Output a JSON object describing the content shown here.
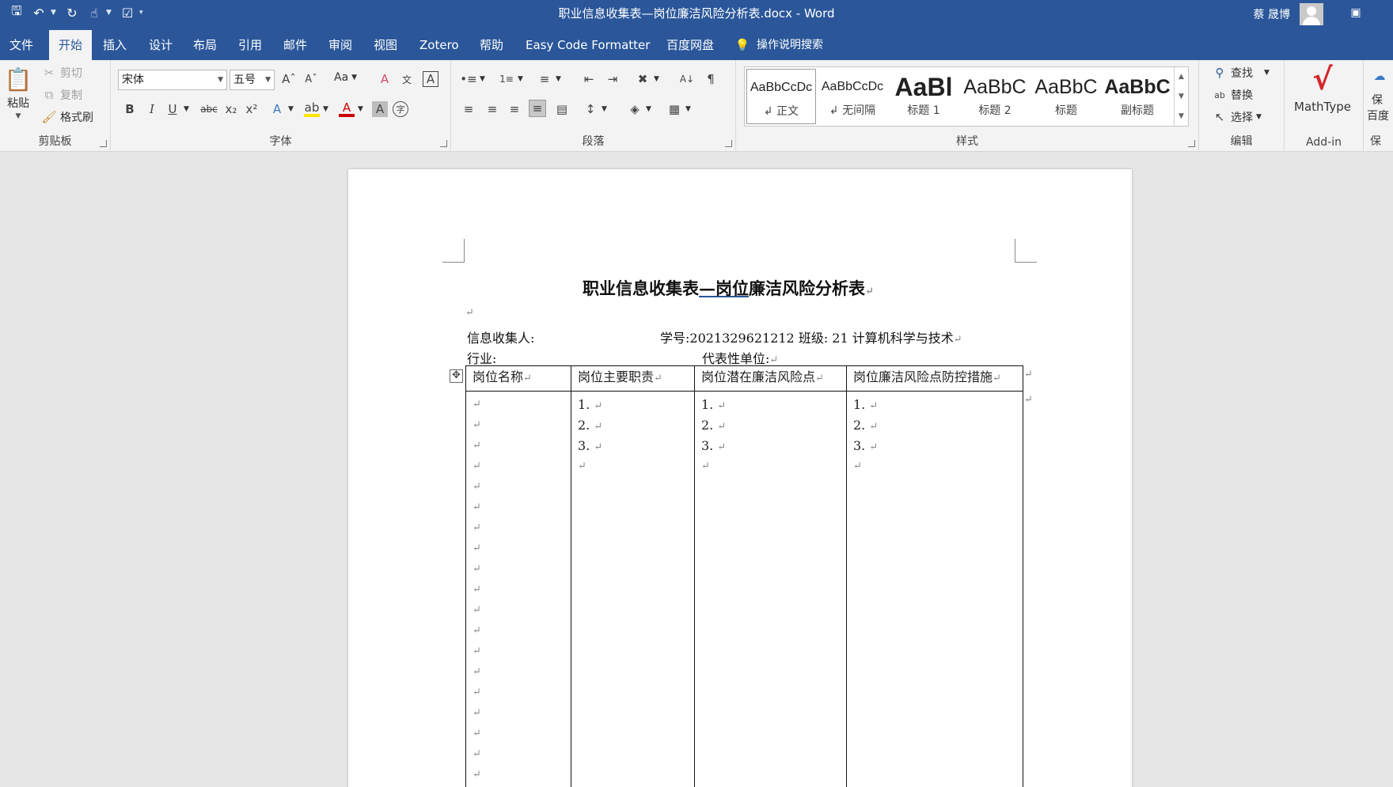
{
  "window": {
    "title": "职业信息收集表—岗位廉洁风险分析表.docx  -  Word",
    "user": "蔡 晟博"
  },
  "tabs": [
    "文件",
    "开始",
    "插入",
    "设计",
    "布局",
    "引用",
    "邮件",
    "审阅",
    "视图",
    "Zotero",
    "帮助",
    "Easy Code Formatter",
    "百度网盘"
  ],
  "active_tab": "开始",
  "tell_me": "操作说明搜索",
  "ribbon": {
    "clipboard": {
      "paste": "粘贴",
      "cut": "剪切",
      "copy": "复制",
      "format_painter": "格式刷",
      "label": "剪贴板"
    },
    "font": {
      "name": "宋体",
      "size": "五号",
      "label": "字体",
      "change_case": "Aa"
    },
    "paragraph": {
      "label": "段落"
    },
    "styles": {
      "label": "样式",
      "items": [
        {
          "preview": "AaBbCcDc",
          "name": "↲ 正文"
        },
        {
          "preview": "AaBbCcDc",
          "name": "↲ 无间隔"
        },
        {
          "preview": "AaBl",
          "name": "标题 1"
        },
        {
          "preview": "AaBbC",
          "name": "标题 2"
        },
        {
          "preview": "AaBbC",
          "name": "标题"
        },
        {
          "preview": "AaBbC",
          "name": "副标题"
        }
      ]
    },
    "editing": {
      "find": "查找",
      "replace": "替换",
      "select": "选择",
      "label": "编辑"
    },
    "addin": {
      "mathtype": "MathType",
      "label": "Add-in"
    },
    "extra": {
      "top": "保",
      "mid": "百度",
      "bottom": "保"
    }
  },
  "document": {
    "title_a": "职业信息收集表",
    "title_b": "—岗位",
    "title_c": "廉洁风险分析表",
    "collector": "信息收集人:",
    "student_info": "学号:2021329621212   班级: 21 计算机科学与技术",
    "industry": "行业:",
    "company": "代表性单位:",
    "para_mark": "↵",
    "table": {
      "headers": [
        "岗位名称",
        "岗位主要职责",
        "岗位潜在廉洁风险点",
        "岗位廉洁风险点防控措施"
      ],
      "numbered": [
        "1.",
        "2.",
        "3."
      ]
    }
  }
}
